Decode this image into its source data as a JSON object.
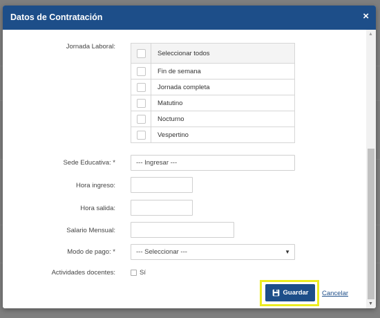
{
  "modal": {
    "title": "Datos de Contratación",
    "close_glyph": "×"
  },
  "form": {
    "jornada": {
      "label": "Jornada Laboral:",
      "options": [
        {
          "label": "Seleccionar todos",
          "checked": false
        },
        {
          "label": "Fin de semana",
          "checked": false
        },
        {
          "label": "Jornada completa",
          "checked": false
        },
        {
          "label": "Matutino",
          "checked": false
        },
        {
          "label": "Nocturno",
          "checked": false
        },
        {
          "label": "Vespertino",
          "checked": false
        }
      ]
    },
    "sede": {
      "label": "Sede Educativa: *",
      "value": "--- Ingresar ---"
    },
    "hora_ingreso": {
      "label": "Hora ingreso:",
      "value": ""
    },
    "hora_salida": {
      "label": "Hora salida:",
      "value": ""
    },
    "salario": {
      "label": "Salario Mensual:",
      "value": ""
    },
    "modo_pago": {
      "label": "Modo de pago: *",
      "value": "--- Seleccionar ---"
    },
    "actividades": {
      "label": "Actividades docentes:",
      "option_label": "Sí",
      "checked": false
    }
  },
  "footer": {
    "save_label": "Guardar",
    "cancel_label": "Cancelar",
    "save_icon": "floppy-disk-icon"
  },
  "colors": {
    "header": "#1d4e89",
    "highlight": "#ecec1f"
  }
}
